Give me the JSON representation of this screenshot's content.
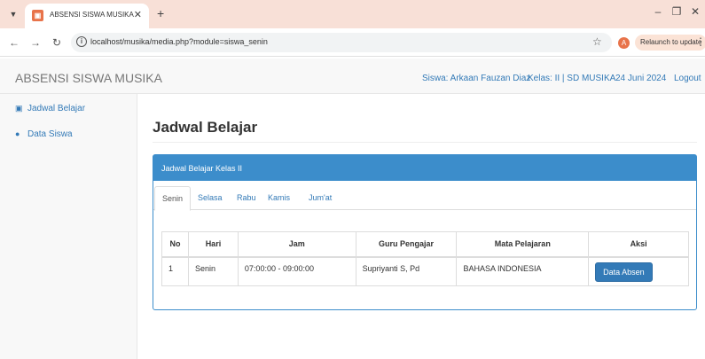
{
  "browser": {
    "tab_title": "ABSENSI SISWA MUSIKA",
    "url": "localhost/musika/media.php?module=siswa_senin",
    "profile_initial": "A",
    "relaunch_label": "Relaunch to update"
  },
  "navbar": {
    "brand": "ABSENSI SISWA MUSIKA",
    "student": "Siswa: Arkaan Fauzan Diaz",
    "class": "Kelas: II | SD MUSIKA",
    "date": "24 Juni 2024",
    "logout": "Logout"
  },
  "sidebar": {
    "items": [
      {
        "label": "Jadwal Belajar",
        "icon": "image-icon"
      },
      {
        "label": "Data Siswa",
        "icon": "users-icon"
      }
    ]
  },
  "main": {
    "title": "Jadwal Belajar",
    "panel_title": "Jadwal Belajar Kelas II",
    "tabs": [
      "Senin",
      "Selasa",
      "Rabu",
      "Kamis",
      "Jum'at"
    ],
    "active_tab": "Senin",
    "table": {
      "headers": [
        "No",
        "Hari",
        "Jam",
        "Guru Pengajar",
        "Mata Pelajaran",
        "Aksi"
      ],
      "rows": [
        {
          "no": "1",
          "hari": "Senin",
          "jam": "07:00:00 - 09:00:00",
          "guru": "Supriyanti S, Pd",
          "mapel": "BAHASA INDONESIA",
          "action": "Data Absen"
        }
      ]
    }
  },
  "colors": {
    "primary": "#337ab7",
    "panel": "#3c8dcb",
    "tabbar": "#f8e0d7",
    "accent": "#e8734a"
  }
}
